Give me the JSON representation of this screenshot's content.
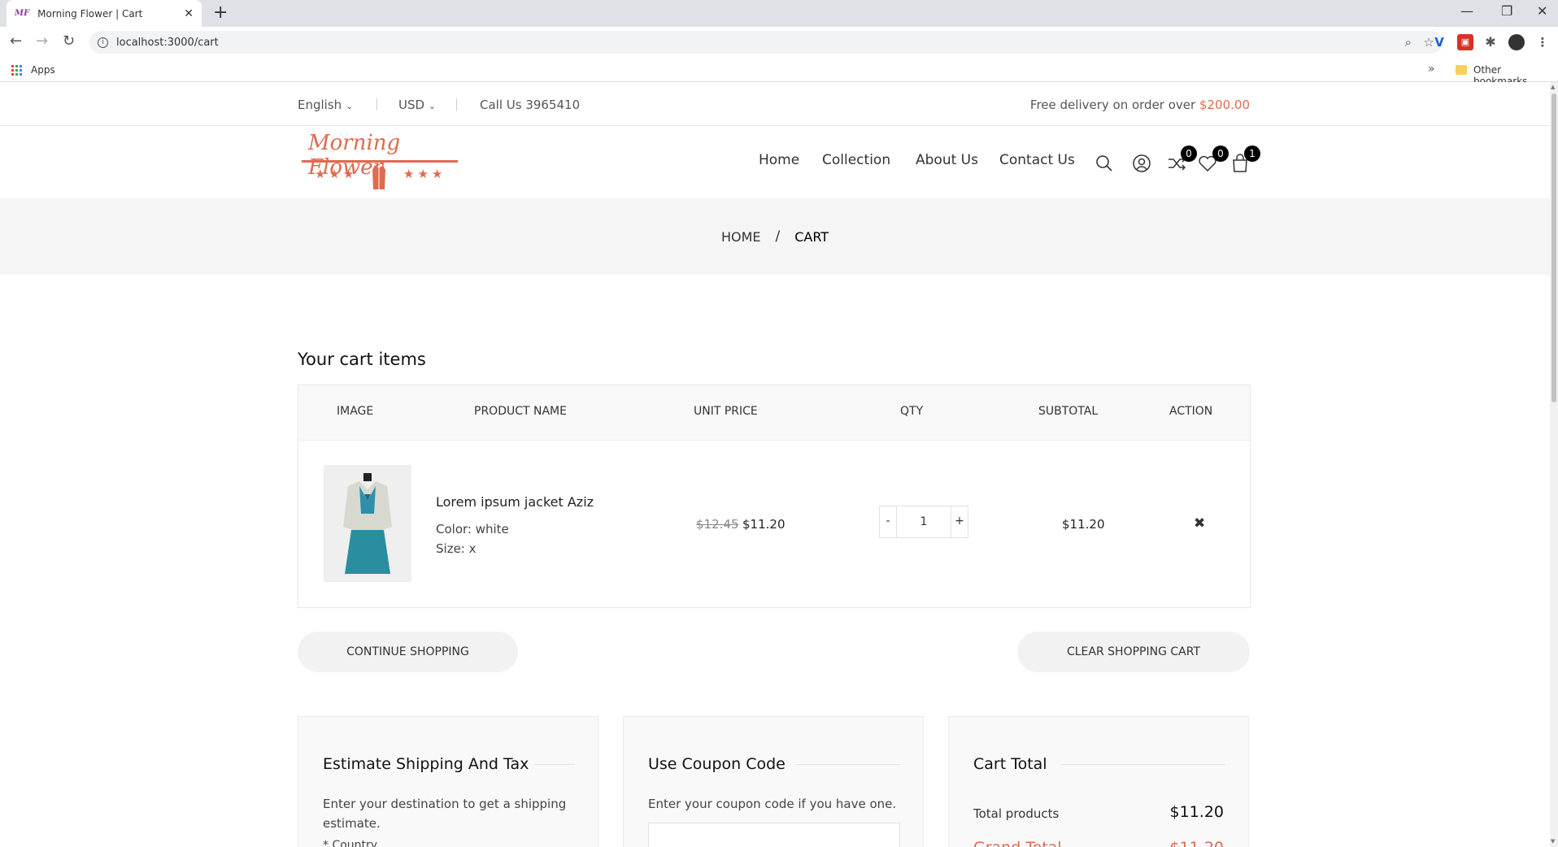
{
  "browser": {
    "tab_title": "Morning Flower | Cart",
    "tab_favicon": "MF",
    "url": "localhost:3000/cart",
    "bookmarks": {
      "apps": "Apps",
      "other": "Other bookmarks"
    }
  },
  "topbar": {
    "language": "English",
    "currency": "USD",
    "call": "Call Us 3965410",
    "free_delivery": "Free delivery on order over ",
    "free_delivery_amount": "$200.00"
  },
  "header": {
    "logo_text": "Morning Flower",
    "nav": [
      "Home",
      "Collection",
      "About Us",
      "Contact Us"
    ],
    "compare_count": "0",
    "wishlist_count": "0",
    "cart_count": "1"
  },
  "breadcrumb": {
    "home": "HOME",
    "separator": "/",
    "current": "CART"
  },
  "cart": {
    "title": "Your cart items",
    "columns": [
      "IMAGE",
      "PRODUCT NAME",
      "UNIT PRICE",
      "QTY",
      "SUBTOTAL",
      "ACTION"
    ],
    "items": [
      {
        "name": "Lorem ipsum jacket Aziz",
        "color": "Color: white",
        "size": "Size: x",
        "old_price": "$12.45",
        "price": "$11.20",
        "qty": "1",
        "subtotal": "$11.20"
      }
    ],
    "continue_label": "CONTINUE SHOPPING",
    "clear_label": "CLEAR SHOPPING CART"
  },
  "shipping": {
    "title": "Estimate Shipping And Tax",
    "text": "Enter your destination to get a shipping estimate.",
    "country_label": "* Country"
  },
  "coupon": {
    "title": "Use Coupon Code",
    "text": "Enter your coupon code if you have one."
  },
  "totals": {
    "title": "Cart Total",
    "total_products_label": "Total products",
    "total_products_value": "$11.20",
    "grand_total_label": "Grand Total",
    "grand_total_value": "$11.20"
  },
  "colors": {
    "accent": "#e06a4f",
    "band": "#f5f5f5"
  }
}
